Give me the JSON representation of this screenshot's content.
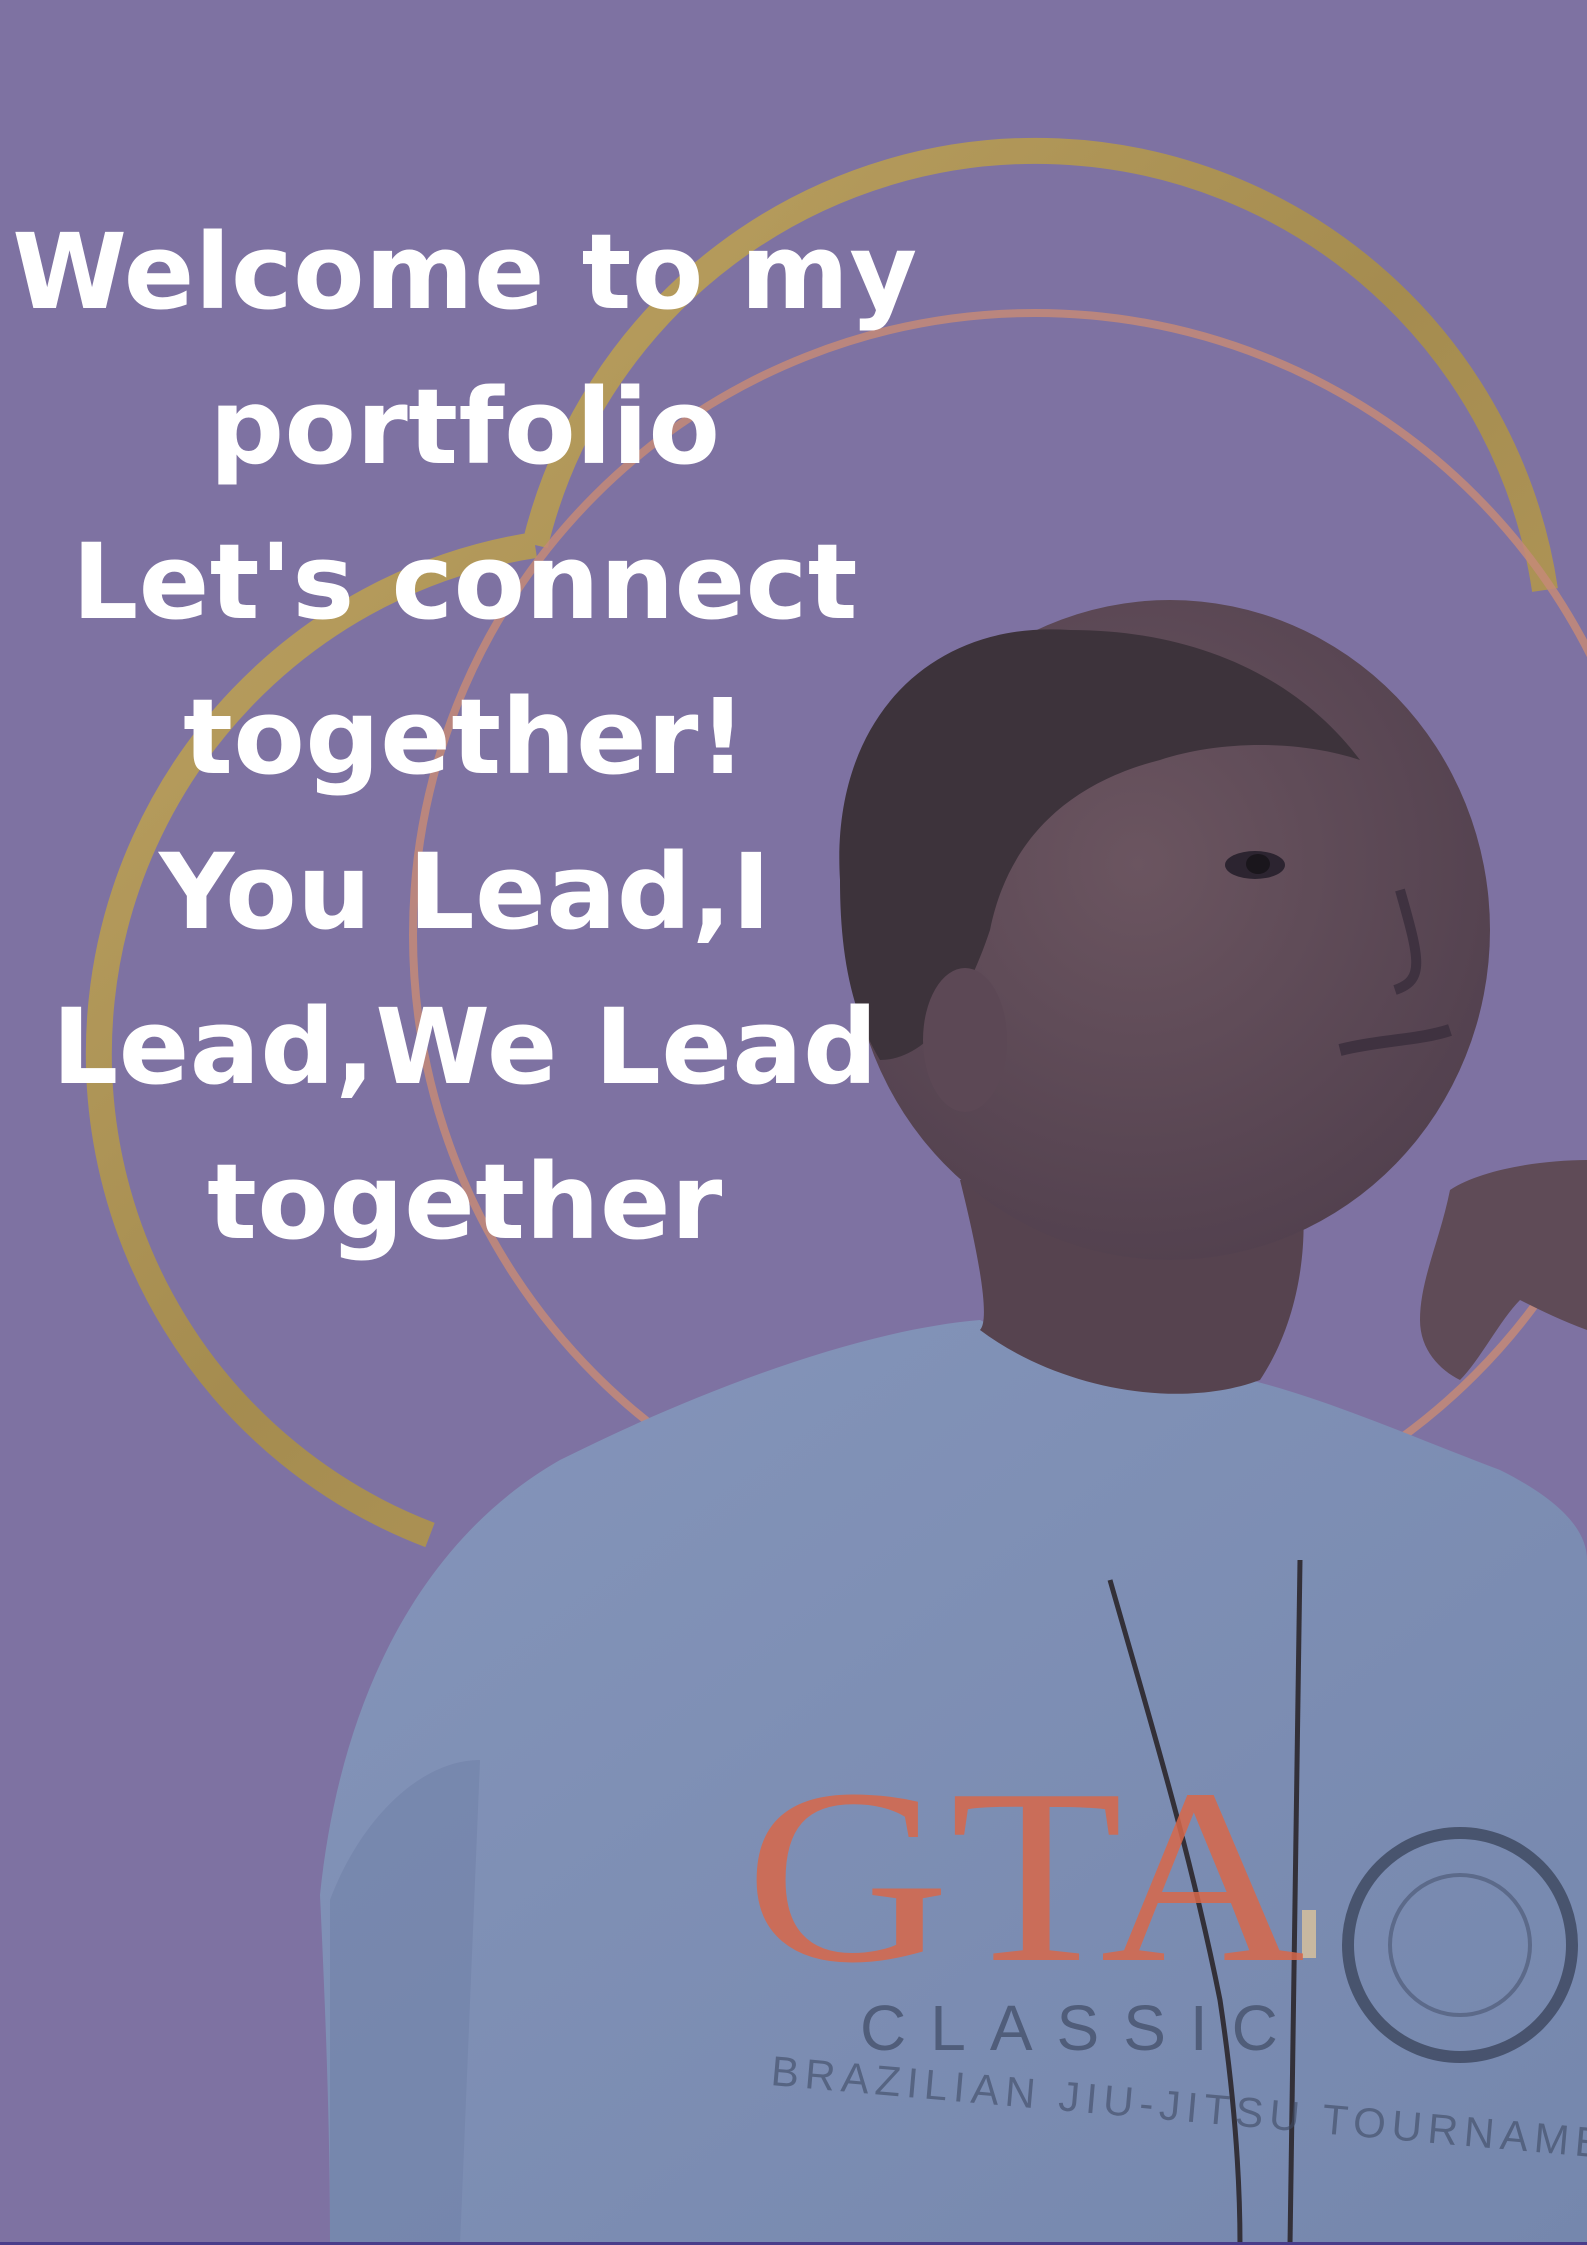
{
  "headline": {
    "lines": [
      "Welcome to my",
      "portfolio",
      "Let's connect",
      "together!",
      "You Lead,I",
      "Lead,We Lead",
      "together"
    ]
  },
  "portrait": {
    "shirt_print": {
      "logo_text": "GTA",
      "sub_text": "CLASSIC",
      "small_text": "BRAZILIAN JIU-JITSU TOURNAMENT"
    }
  },
  "colors": {
    "background": "#7e72a2",
    "ring_gold": "#b59a52",
    "ring_copper": "#c48a78",
    "headline_text": "#ffffff",
    "shirt": "#7e8fb4",
    "shirt_print": "#d8684a"
  }
}
